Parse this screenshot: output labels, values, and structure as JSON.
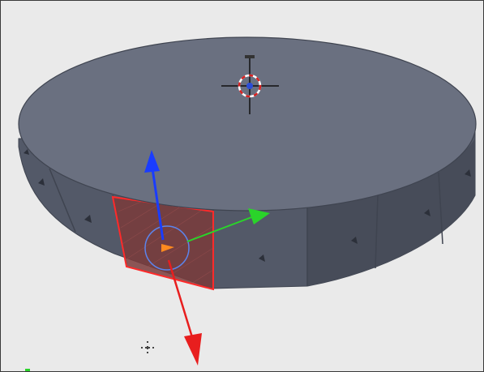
{
  "viewport": {
    "background_color": "#eaeaea",
    "object": {
      "type": "cylinder",
      "top_face_color": "#6a7080",
      "side_face_color": "#535968",
      "side_face_shadow_color": "#474c59",
      "edge_color": "#3f4450",
      "vertex_marker_color": "#2c303a"
    },
    "selection": {
      "selected_face_fill": "#7a3b3b",
      "selected_face_outline": "#ff2a2a",
      "face_center_marker_color": "#ff8a1f",
      "transform_circle_color": "#5a8cff"
    },
    "gizmo": {
      "x_axis_color": "#e81e1e",
      "y_axis_color": "#2ad42a",
      "z_axis_color": "#1a3cff"
    },
    "cursor_3d": {
      "ring_red": "#d82020",
      "ring_white": "#ffffff",
      "crosshair_color": "#111111"
    },
    "icons": [
      "3d-cursor-icon",
      "transform-gizmo-icon",
      "move-pivot-icon"
    ]
  }
}
